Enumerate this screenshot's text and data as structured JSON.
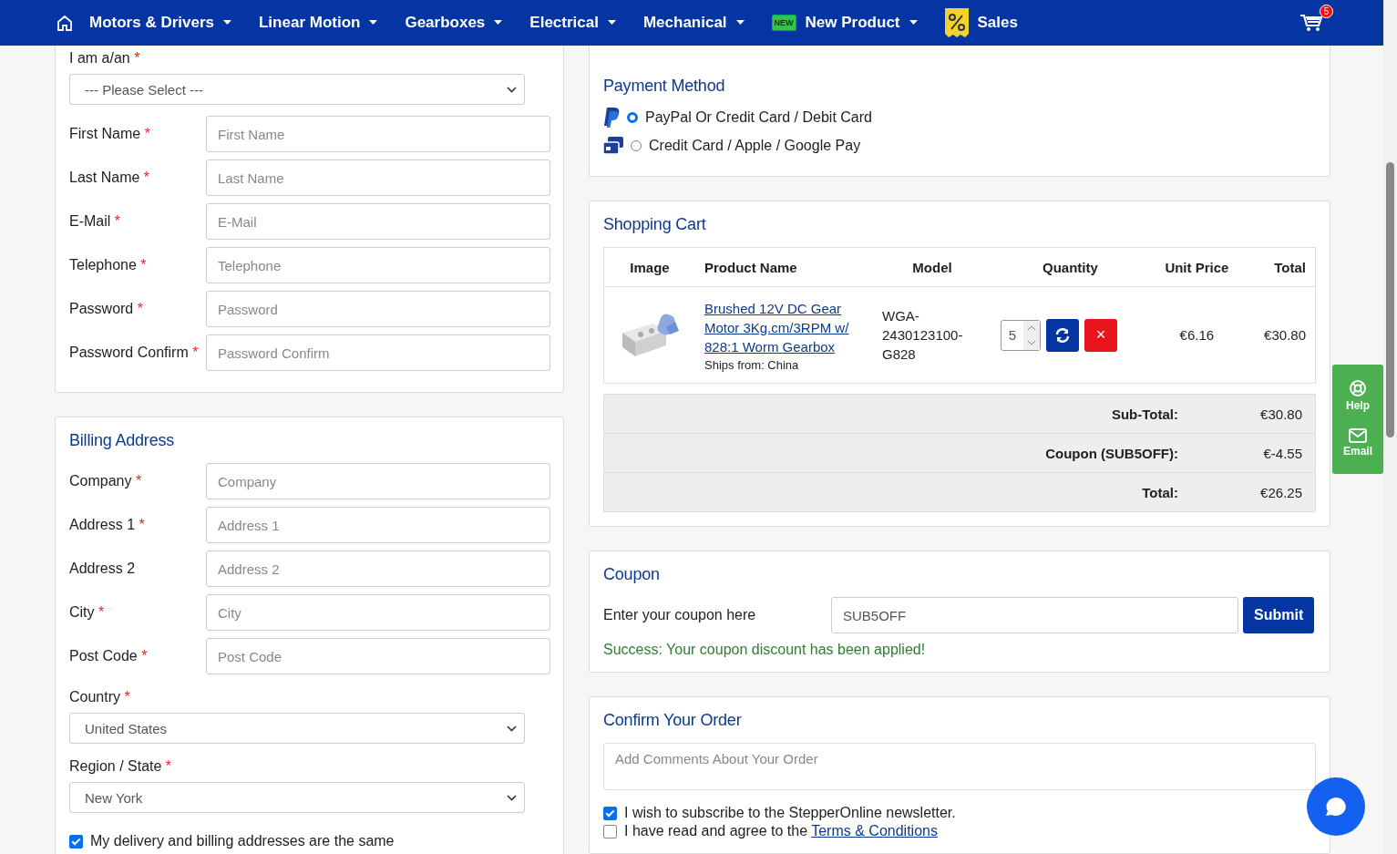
{
  "nav": {
    "items": [
      {
        "label": "Motors & Drivers",
        "dropdown": true
      },
      {
        "label": "Linear Motion",
        "dropdown": true
      },
      {
        "label": "Gearboxes",
        "dropdown": true
      },
      {
        "label": "Electrical",
        "dropdown": true
      },
      {
        "label": "Mechanical",
        "dropdown": true
      },
      {
        "label": "New Product",
        "dropdown": true,
        "kind": "new",
        "badge": "NEW"
      },
      {
        "label": "Sales",
        "dropdown": false,
        "kind": "sale"
      }
    ],
    "cart_count": "5"
  },
  "account": {
    "type_label": "I am a/an",
    "type_required": "*",
    "type_value": "--- Please Select ---",
    "fields": [
      {
        "label": "First Name",
        "required": "*",
        "placeholder": "First Name"
      },
      {
        "label": "Last Name",
        "required": "*",
        "placeholder": "Last Name"
      },
      {
        "label": "E-Mail",
        "required": "*",
        "placeholder": "E-Mail"
      },
      {
        "label": "Telephone",
        "required": "*",
        "placeholder": "Telephone"
      },
      {
        "label": "Password",
        "required": "*",
        "placeholder": "Password"
      },
      {
        "label": "Password Confirm",
        "required": "*",
        "placeholder": "Password Confirm"
      }
    ]
  },
  "billing": {
    "title": "Billing Address",
    "fields": [
      {
        "label": "Company",
        "required": "*",
        "placeholder": "Company"
      },
      {
        "label": "Address 1",
        "required": "*",
        "placeholder": "Address 1"
      },
      {
        "label": "Address 2",
        "placeholder": "Address 2"
      },
      {
        "label": "City",
        "required": "*",
        "placeholder": "City"
      },
      {
        "label": "Post Code",
        "required": "*",
        "placeholder": "Post Code"
      }
    ],
    "selects": [
      {
        "label": "Country",
        "required": "*",
        "value": "United States"
      },
      {
        "label": "Region / State",
        "required": "*",
        "value": "New York"
      }
    ],
    "same_address": {
      "label": "My delivery and billing addresses are the same",
      "checked": true
    }
  },
  "payment": {
    "title": "Payment Method",
    "options": [
      {
        "kind": "paypal",
        "label": "PayPal Or Credit Card / Debit Card",
        "selected": true
      },
      {
        "kind": "card",
        "label": "Credit Card / Apple / Google Pay",
        "selected": false
      }
    ]
  },
  "cart": {
    "title": "Shopping Cart",
    "columns": [
      "Image",
      "Product Name",
      "Model",
      "Quantity",
      "Unit Price",
      "Total"
    ],
    "rows": [
      {
        "name": "Brushed 12V DC Gear Motor 3Kg.cm/3RPM w/ 828:1 Worm Gearbox",
        "ships": "Ships from: China",
        "model": "WGA-2430123100-G828",
        "quantity": "5",
        "remove": "×",
        "unit_price": "€6.16",
        "total": "€30.80"
      }
    ],
    "totals": [
      {
        "label": "Sub-Total:",
        "value": "€30.80"
      },
      {
        "label": "Coupon (SUB5OFF):",
        "value": "€-4.55"
      },
      {
        "label": "Total:",
        "value": "€26.25"
      }
    ]
  },
  "coupon": {
    "title": "Coupon",
    "label": "Enter your coupon here",
    "value": "SUB5OFF",
    "button": "Submit",
    "message": "Success: Your coupon discount has been applied!"
  },
  "confirm": {
    "title": "Confirm Your Order",
    "comment_placeholder": "Add Comments About Your Order",
    "checks": [
      {
        "text": "I wish to subscribe to the StepperOnline newsletter.",
        "checked": true
      },
      {
        "text": "I have read and agree to the ",
        "link": "Terms & Conditions",
        "checked": false
      }
    ]
  },
  "side": {
    "items": [
      {
        "kind": "help",
        "label": "Help"
      },
      {
        "kind": "email",
        "label": "Email"
      }
    ]
  }
}
